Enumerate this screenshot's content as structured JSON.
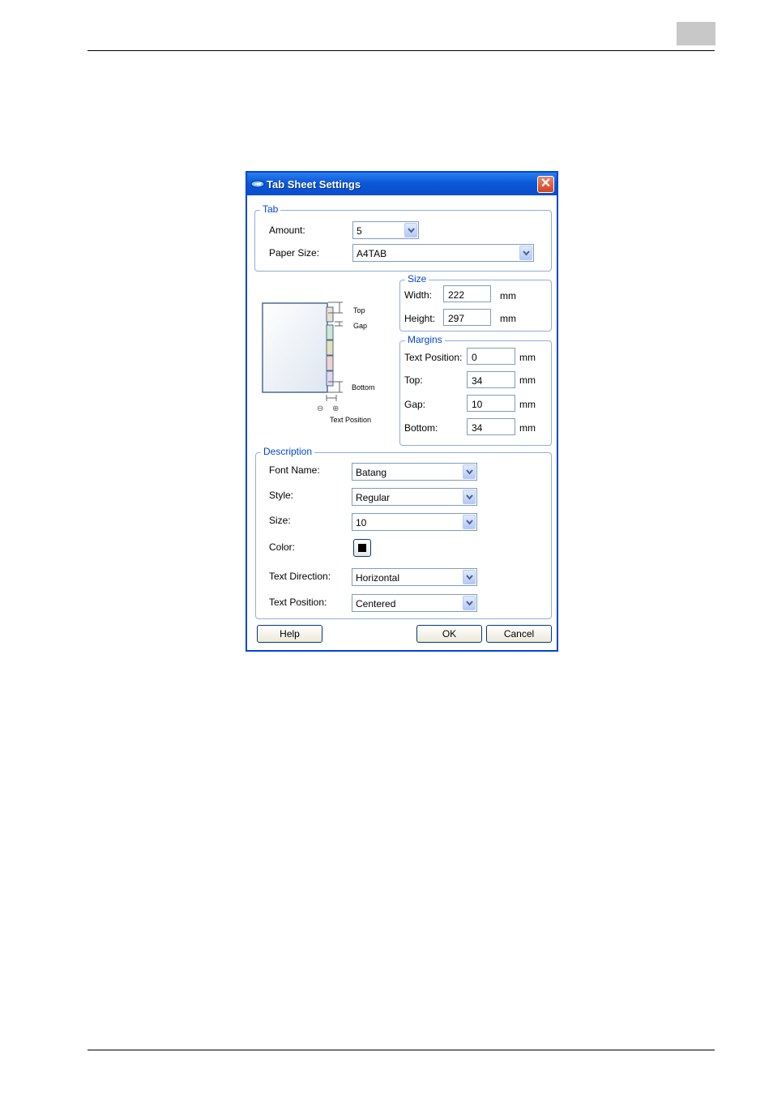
{
  "dialog": {
    "title": "Tab Sheet Settings",
    "close_glyph": "✕",
    "tab_group": {
      "legend": "Tab",
      "amount_label": "Amount:",
      "amount_value": "5",
      "paper_size_label": "Paper Size:",
      "paper_size_value": "A4TAB"
    },
    "size_group": {
      "legend": "Size",
      "width_label": "Width:",
      "width_value": "222",
      "width_unit": "mm",
      "height_label": "Height:",
      "height_value": "297",
      "height_unit": "mm"
    },
    "margins_group": {
      "legend": "Margins",
      "text_position_label": "Text Position:",
      "text_position_value": "0",
      "top_label": "Top:",
      "top_value": "34",
      "gap_label": "Gap:",
      "gap_value": "10",
      "bottom_label": "Bottom:",
      "bottom_value": "34",
      "unit": "mm"
    },
    "diagram": {
      "top_label": "Top",
      "gap_label": "Gap",
      "bottom_label": "Bottom",
      "text_position_label": "Text Position",
      "minus_glyph": "⊖",
      "plus_glyph": "⊕"
    },
    "description_group": {
      "legend": "Description",
      "font_name_label": "Font Name:",
      "font_name_value": "Batang",
      "style_label": "Style:",
      "style_value": "Regular",
      "size_label": "Size:",
      "size_value": "10",
      "color_label": "Color:",
      "color_value": "#000000",
      "text_direction_label": "Text Direction:",
      "text_direction_value": "Horizontal",
      "text_position_label": "Text Position:",
      "text_position_value": "Centered"
    },
    "buttons": {
      "help": "Help",
      "ok": "OK",
      "cancel": "Cancel"
    }
  }
}
